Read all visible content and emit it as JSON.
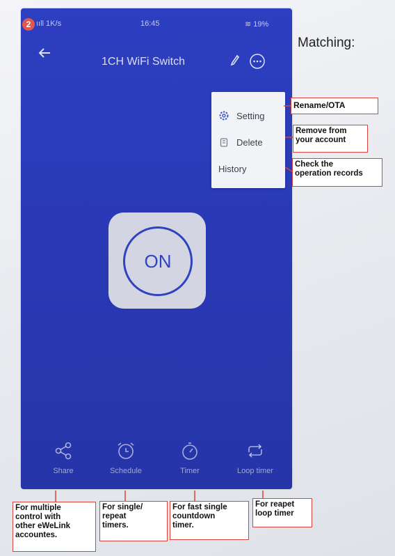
{
  "badge": {
    "number": "2"
  },
  "status_bar": {
    "signal": "ııll 1K/s",
    "time": "16:45",
    "battery": "≋ 19%"
  },
  "header": {
    "title": "1CH WiFi Switch"
  },
  "menu": {
    "items": [
      {
        "label": "Setting",
        "icon": "gear-icon"
      },
      {
        "label": "Delete",
        "icon": "trash-icon"
      },
      {
        "label": "History"
      }
    ]
  },
  "power": {
    "label": "ON"
  },
  "tabs": [
    {
      "label": "Share",
      "icon": "share-icon"
    },
    {
      "label": "Schedule",
      "icon": "alarm-clock-icon"
    },
    {
      "label": "Timer",
      "icon": "stopwatch-icon"
    },
    {
      "label": "Loop timer",
      "icon": "loop-icon"
    }
  ],
  "annotations": {
    "title": "Matching:",
    "rename": "Rename/OTA",
    "delete": [
      "Remove from",
      "your account"
    ],
    "history": [
      "Check the",
      "operation records"
    ],
    "share": [
      "For multiple",
      "control with",
      "other eWeLink",
      "accountes."
    ],
    "schedule": [
      "For single/",
      "repeat",
      "timers."
    ],
    "timer": [
      "For fast single",
      "countdown",
      "timer."
    ],
    "loop": [
      "For reapet",
      "loop timer"
    ]
  },
  "colors": {
    "app_blue": "#2a3ab6",
    "annotation_red": "#d9433b",
    "badge_red": "#e2574c"
  }
}
